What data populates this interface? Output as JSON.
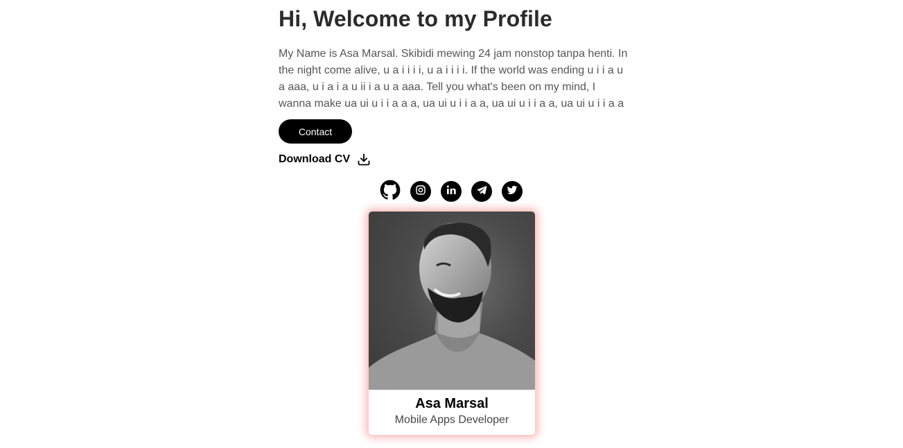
{
  "hero": {
    "title": "Hi, Welcome to my Profile",
    "description": "My Name is Asa Marsal. Skibidi mewing 24 jam nonstop tanpa henti. In the night come alive, u a i i i i, u a i i i i. If the world was ending u i i a u a aaa, u i a i a u ii i a u a aaa. Tell you what's been on my mind, I wanna make ua ui u i i a a a, ua ui u i i a a, ua ui u i i a a, ua ui u i i a a",
    "contact_label": "Contact",
    "download_label": "Download CV"
  },
  "socials": [
    {
      "name": "GitHub",
      "icon": "github-icon"
    },
    {
      "name": "Instagram",
      "icon": "instagram-icon"
    },
    {
      "name": "LinkedIn",
      "icon": "linkedin-icon"
    },
    {
      "name": "Telegram",
      "icon": "telegram-icon"
    },
    {
      "name": "Twitter",
      "icon": "twitter-icon"
    }
  ],
  "profile_card": {
    "name": "Asa Marsal",
    "role": "Mobile Apps Developer",
    "photo": "grayscale-portrait-photo"
  },
  "colors": {
    "text": "#2b2b2b",
    "button": "#000000",
    "card_glow": "#f05a5a"
  }
}
